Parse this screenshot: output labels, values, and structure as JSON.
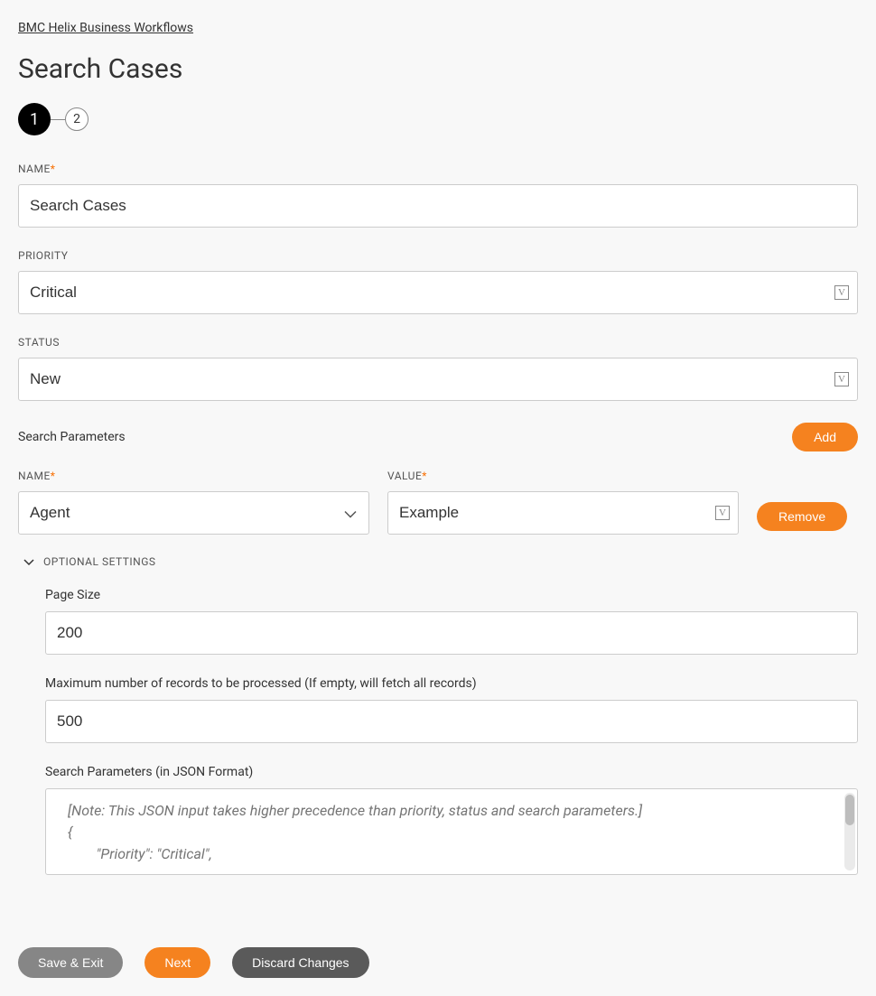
{
  "breadcrumb": "BMC Helix Business Workflows",
  "title": "Search Cases",
  "stepper": {
    "step1": "1",
    "step2": "2"
  },
  "fields": {
    "name_label": "NAME",
    "name_value": "Search Cases",
    "priority_label": "PRIORITY",
    "priority_value": "Critical",
    "status_label": "STATUS",
    "status_value": "New"
  },
  "search_params": {
    "section_label": "Search Parameters",
    "add_label": "Add",
    "name_label": "NAME",
    "name_value": "Agent",
    "value_label": "VALUE",
    "value_value": "Example",
    "remove_label": "Remove"
  },
  "optional": {
    "toggle_label": "OPTIONAL SETTINGS",
    "page_size_label": "Page Size",
    "page_size_value": "200",
    "max_records_label": "Maximum number of records to be processed (If empty, will fetch all records)",
    "max_records_value": "500",
    "json_label": "Search Parameters (in JSON Format)",
    "json_placeholder": "[Note: This JSON input takes higher precedence than priority, status and search parameters.]\n{\n        \"Priority\": \"Critical\","
  },
  "footer": {
    "save_exit": "Save & Exit",
    "next": "Next",
    "discard": "Discard Changes"
  }
}
